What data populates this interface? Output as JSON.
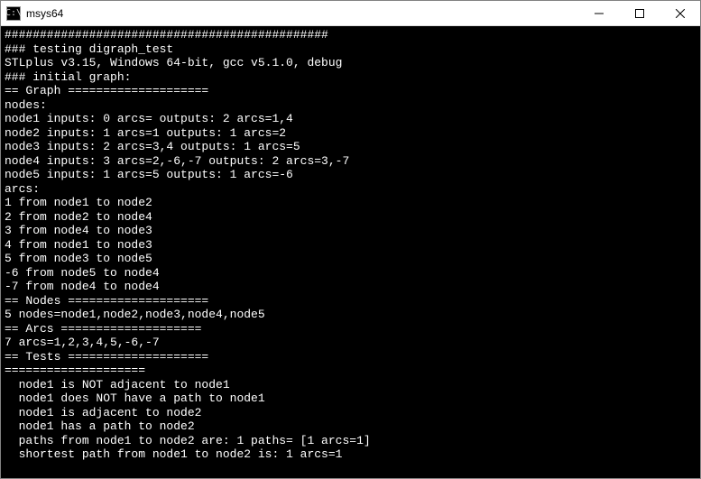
{
  "window": {
    "title": "msys64",
    "icon_label": "C:\\"
  },
  "terminal": {
    "lines": [
      "##############################################",
      "### testing digraph_test",
      "STLplus v3.15, Windows 64-bit, gcc v5.1.0, debug",
      "### initial graph:",
      "== Graph ====================",
      "nodes:",
      "node1 inputs: 0 arcs= outputs: 2 arcs=1,4",
      "node2 inputs: 1 arcs=1 outputs: 1 arcs=2",
      "node3 inputs: 2 arcs=3,4 outputs: 1 arcs=5",
      "node4 inputs: 3 arcs=2,-6,-7 outputs: 2 arcs=3,-7",
      "node5 inputs: 1 arcs=5 outputs: 1 arcs=-6",
      "arcs:",
      "1 from node1 to node2",
      "2 from node2 to node4",
      "3 from node4 to node3",
      "4 from node1 to node3",
      "5 from node3 to node5",
      "-6 from node5 to node4",
      "-7 from node4 to node4",
      "== Nodes ====================",
      "5 nodes=node1,node2,node3,node4,node5",
      "== Arcs ====================",
      "7 arcs=1,2,3,4,5,-6,-7",
      "== Tests ====================",
      "====================",
      "  node1 is NOT adjacent to node1",
      "  node1 does NOT have a path to node1",
      "  node1 is adjacent to node2",
      "  node1 has a path to node2",
      "  paths from node1 to node2 are: 1 paths= [1 arcs=1]",
      "  shortest path from node1 to node2 is: 1 arcs=1"
    ]
  }
}
